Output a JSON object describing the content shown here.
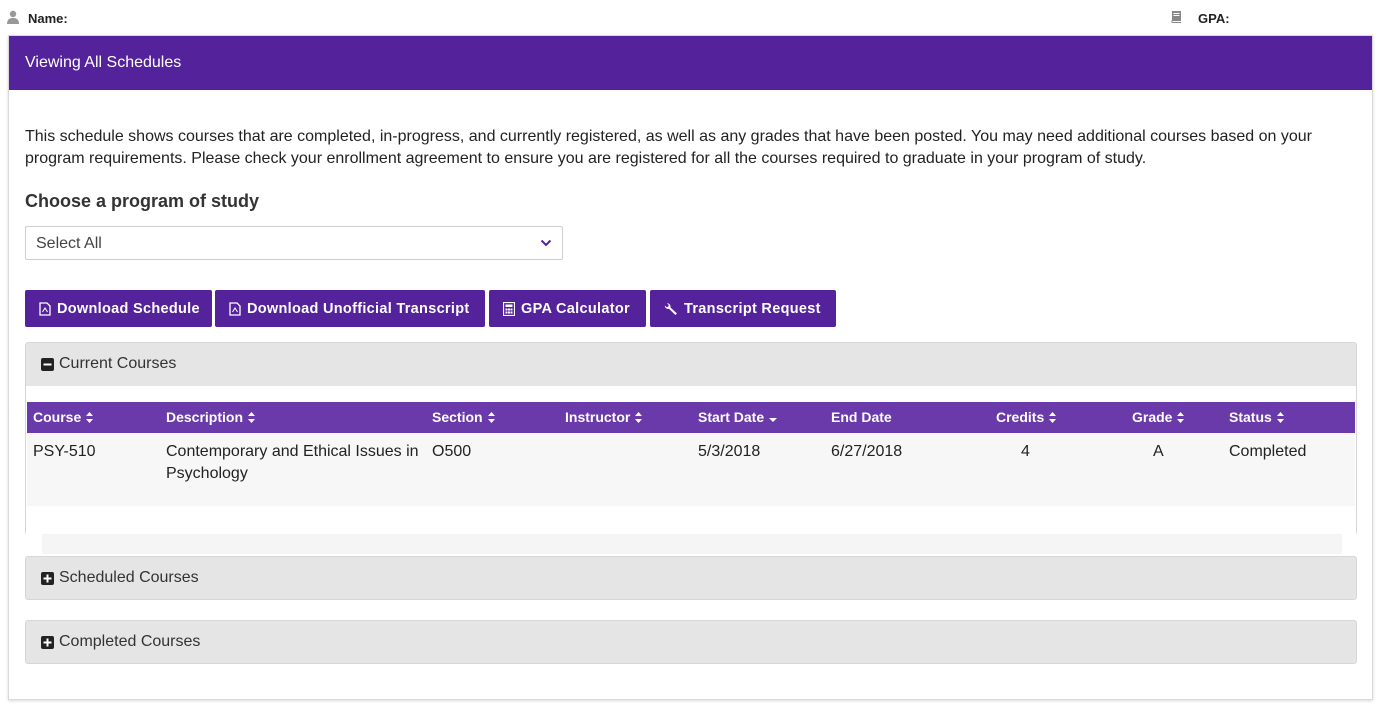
{
  "header": {
    "name_label": "Name:",
    "gpa_label": "GPA:",
    "user_icon": "user-icon",
    "book_icon": "book-icon"
  },
  "panel": {
    "title": "Viewing All Schedules",
    "intro": "This schedule shows courses that are completed, in-progress, and currently registered, as well as any grades that have been posted. You may need additional courses based on your program requirements. Please check your enrollment agreement to ensure you are registered for all the courses required to graduate in your program of study.",
    "choose_label": "Choose a program of study",
    "program_select": {
      "value": "Select All"
    }
  },
  "buttons": [
    {
      "label": "Download Schedule",
      "icon": "pdf-icon"
    },
    {
      "label": "Download Unofficial Transcript",
      "icon": "pdf-icon"
    },
    {
      "label": "GPA Calculator",
      "icon": "calculator-icon"
    },
    {
      "label": "Transcript Request",
      "icon": "wrench-icon"
    }
  ],
  "sections": {
    "current": {
      "title": "Current Courses",
      "expanded": true,
      "columns": [
        "Course",
        "Description",
        "Section",
        "Instructor",
        "Start Date",
        "End Date",
        "Credits",
        "Grade",
        "Status"
      ],
      "rows": [
        {
          "course": "PSY-510",
          "description": "Contemporary and Ethical Issues in Psychology",
          "section": "O500",
          "instructor": "",
          "start_date": "5/3/2018",
          "end_date": "6/27/2018",
          "credits": "4",
          "grade": "A",
          "status": "Completed"
        }
      ]
    },
    "scheduled": {
      "title": "Scheduled Courses",
      "expanded": false
    },
    "completed": {
      "title": "Completed Courses",
      "expanded": false
    }
  },
  "colors": {
    "brand_purple": "#54229a",
    "table_header": "#6a3aaa",
    "accordion_bg": "#e5e5e5"
  }
}
